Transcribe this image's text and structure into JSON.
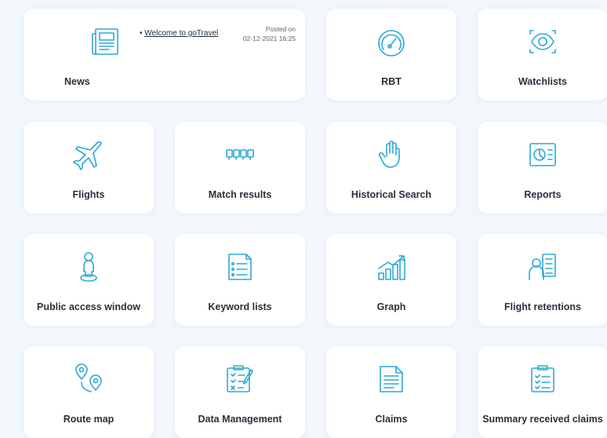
{
  "colors": {
    "background": "#f2f7fb",
    "tile": "#ffffff",
    "icon_accent": "#2aa8d8",
    "label": "#27313b"
  },
  "news": {
    "label": "News",
    "item_bullet": "•",
    "item_link": "Welcome to goTravel",
    "posted_label": "Posted on",
    "posted_date": "02-12-2021 16:25",
    "icon": "newspaper-icon"
  },
  "tiles": [
    {
      "label": "RBT",
      "icon": "speedometer-icon"
    },
    {
      "label": "Watchlists",
      "icon": "eye-scan-icon"
    },
    {
      "label": "Flights",
      "icon": "airplane-icon"
    },
    {
      "label": "Match results",
      "icon": "match-results-icon"
    },
    {
      "label": "Historical Search",
      "icon": "hand-icon"
    },
    {
      "label": "Reports",
      "icon": "report-chart-icon"
    },
    {
      "label": "Public access window",
      "icon": "person-location-icon"
    },
    {
      "label": "Keyword lists",
      "icon": "list-document-icon"
    },
    {
      "label": "Graph",
      "icon": "growth-graph-icon"
    },
    {
      "label": "Flight retentions",
      "icon": "retention-icon"
    },
    {
      "label": "Route map",
      "icon": "route-map-icon"
    },
    {
      "label": "Data Management",
      "icon": "checklist-clipboard-icon"
    },
    {
      "label": "Claims",
      "icon": "claims-document-icon"
    },
    {
      "label": "Summary received claims",
      "icon": "clipboard-summary-icon"
    }
  ]
}
